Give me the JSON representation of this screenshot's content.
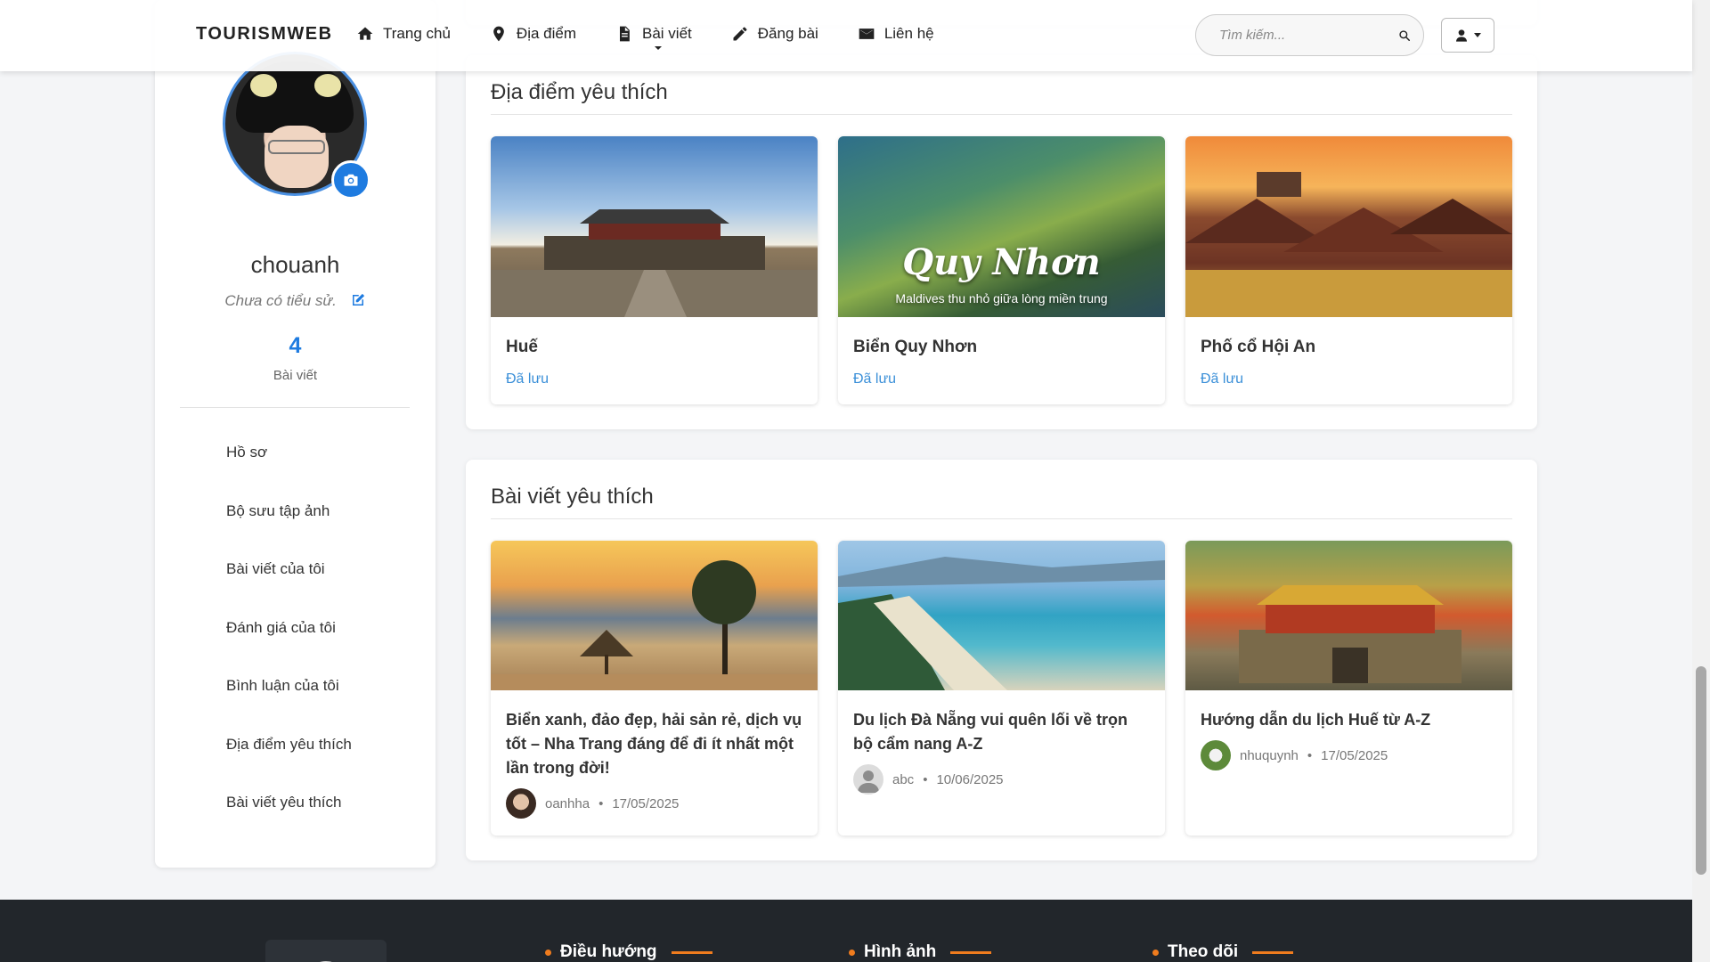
{
  "navbar": {
    "brand": "TOURISMWEB",
    "links": [
      {
        "label": "Trang chủ",
        "icon": "home-icon"
      },
      {
        "label": "Địa điểm",
        "icon": "map-pin-icon"
      },
      {
        "label": "Bài viết",
        "icon": "file-icon"
      },
      {
        "label": "Đăng bài",
        "icon": "pencil-icon"
      },
      {
        "label": "Liên hệ",
        "icon": "envelope-icon"
      }
    ],
    "search_placeholder": "Tìm kiếm...",
    "user_menu_icon": "user-icon"
  },
  "profile": {
    "username": "chouanh",
    "bio": "Chưa có tiểu sử.",
    "post_count": "4",
    "post_count_label": "Bài viết"
  },
  "sidebar_menu": [
    "Hồ sơ",
    "Bộ sưu tập ảnh",
    "Bài viết của tôi",
    "Đánh giá của tôi",
    "Bình luận của tôi",
    "Địa điểm yêu thích",
    "Bài viết yêu thích"
  ],
  "favorite_places": {
    "title": "Địa điểm yêu thích",
    "items": [
      {
        "name": "Huế",
        "status": "Đã lưu"
      },
      {
        "name": "Biển Quy Nhơn",
        "status": "Đã lưu",
        "image_text": "Quy Nhơn",
        "image_subtext": "Maldives thu nhỏ giữa lòng miền trung"
      },
      {
        "name": "Phố cổ Hội An",
        "status": "Đã lưu"
      }
    ]
  },
  "favorite_posts": {
    "title": "Bài viết yêu thích",
    "items": [
      {
        "title": "Biển xanh, đảo đẹp, hải sản rẻ, dịch vụ tốt – Nha Trang đáng để đi ít nhất một lần trong đời!",
        "author": "oanhha",
        "date": "17/05/2025"
      },
      {
        "title": "Du lịch Đà Nẵng vui quên lối về trọn bộ cẩm nang A-Z",
        "author": "abc",
        "date": "10/06/2025"
      },
      {
        "title": "Hướng dẫn du lịch Huế từ A-Z",
        "author": "nhuquynh",
        "date": "17/05/2025"
      }
    ]
  },
  "footer": {
    "headings": [
      "Điều hướng",
      "Hình ảnh",
      "Theo dõi"
    ]
  },
  "colors": {
    "accent": "#1e7be0",
    "saved_link": "#3a8fd8",
    "footer_bg": "#22262b",
    "footer_accent": "#f07c1e"
  }
}
